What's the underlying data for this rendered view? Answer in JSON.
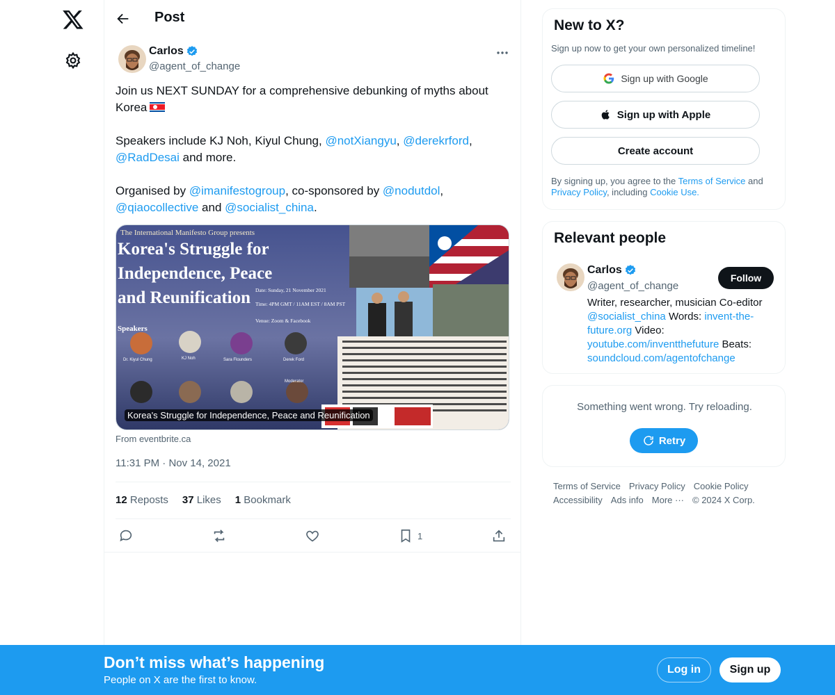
{
  "header": {
    "title": "Post"
  },
  "tweet": {
    "author_name": "Carlos",
    "author_handle": "@agent_of_change",
    "text_line1": "Join us NEXT SUNDAY for a comprehensive debunking of myths about Korea",
    "speakers_prefix": "Speakers include KJ Noh, Kiyul Chung, ",
    "mention_notxiangyu": "@notXiangyu",
    "comma1": ", ",
    "mention_derekrford": "@derekrford",
    "comma2": ",",
    "mention_raddesai": "@RadDesai",
    "speakers_suffix": " and more.",
    "organised_prefix": "Organised by ",
    "mention_imanifestogroup": "@imanifestogroup",
    "cosponsored": ", co-sponsored by ",
    "mention_nodutdol": "@nodutdol",
    "comma3": ",",
    "mention_qiaocollective": "@qiaocollective",
    "and_word": " and ",
    "mention_socialist_china": "@socialist_china",
    "period": ".",
    "media_caption": "Korea's Struggle for Independence, Peace and Reunification",
    "poster_kicker": "The International Manifesto Group presents",
    "poster_title_1": "Korea's Struggle for",
    "poster_title_2": "Independence, Peace",
    "poster_title_3": "and Reunification",
    "poster_date": "Date: Sunday, 21 November 2021",
    "poster_time": "Time: 4PM GMT / 11AM EST / 8AM PST",
    "poster_venue": "Venue: Zoom & Facebook",
    "poster_speakers_label": "Speakers",
    "poster_speakers": [
      "Dr. Kiyul Chung",
      "KJ Noh",
      "Sara Flounders",
      "Derek Ford"
    ],
    "poster_moderator_label": "Moderator",
    "link_domain": "From eventbrite.ca",
    "time": "11:31 PM",
    "date": "Nov 14, 2021",
    "reposts_count": "12",
    "reposts_label": "Reposts",
    "likes_count": "37",
    "likes_label": "Likes",
    "bookmarks_count": "1",
    "bookmarks_label": "Bookmark",
    "bookmark_action_count": "1"
  },
  "signup_card": {
    "title": "New to X?",
    "subtitle": "Sign up now to get your own personalized timeline!",
    "google": "Sign up with Google",
    "apple": "Sign up with Apple",
    "create": "Create account",
    "legal_1": "By signing up, you agree to the ",
    "terms": "Terms of Service",
    "legal_2": " and ",
    "privacy": "Privacy Policy",
    "legal_3": ", including ",
    "cookie": "Cookie Use."
  },
  "relevant": {
    "title": "Relevant people",
    "name": "Carlos",
    "handle": "@agent_of_change",
    "follow": "Follow",
    "bio_1": "Writer, researcher, musician Co-editor ",
    "bio_link1": "@socialist_china",
    "bio_2": " Words: ",
    "bio_link2": "invent-the-future.org",
    "bio_3": " Video: ",
    "bio_link3": "youtube.com/inventthefuture",
    "bio_4": " Beats: ",
    "bio_link4": "soundcloud.com/agentofchange"
  },
  "trends": {
    "error": "Something went wrong. Try reloading.",
    "retry": "Retry"
  },
  "footer": {
    "links": [
      "Terms of Service",
      "Privacy Policy",
      "Cookie Policy",
      "Accessibility",
      "Ads info",
      "More ···",
      "© 2024 X Corp."
    ]
  },
  "bottom_bar": {
    "headline": "Don’t miss what’s happening",
    "sub": "People on X are the first to know.",
    "login": "Log in",
    "signup": "Sign up"
  },
  "colors": {
    "accent": "#1d9bf0",
    "text": "#0f1419",
    "muted": "#536471",
    "border": "#eff3f4"
  },
  "icons": [
    "x-logo-icon",
    "gear-icon",
    "back-arrow-icon",
    "verified-badge-icon",
    "more-icon",
    "reply-icon",
    "repost-icon",
    "like-icon",
    "bookmark-icon",
    "share-icon",
    "google-icon",
    "apple-icon",
    "refresh-icon"
  ]
}
